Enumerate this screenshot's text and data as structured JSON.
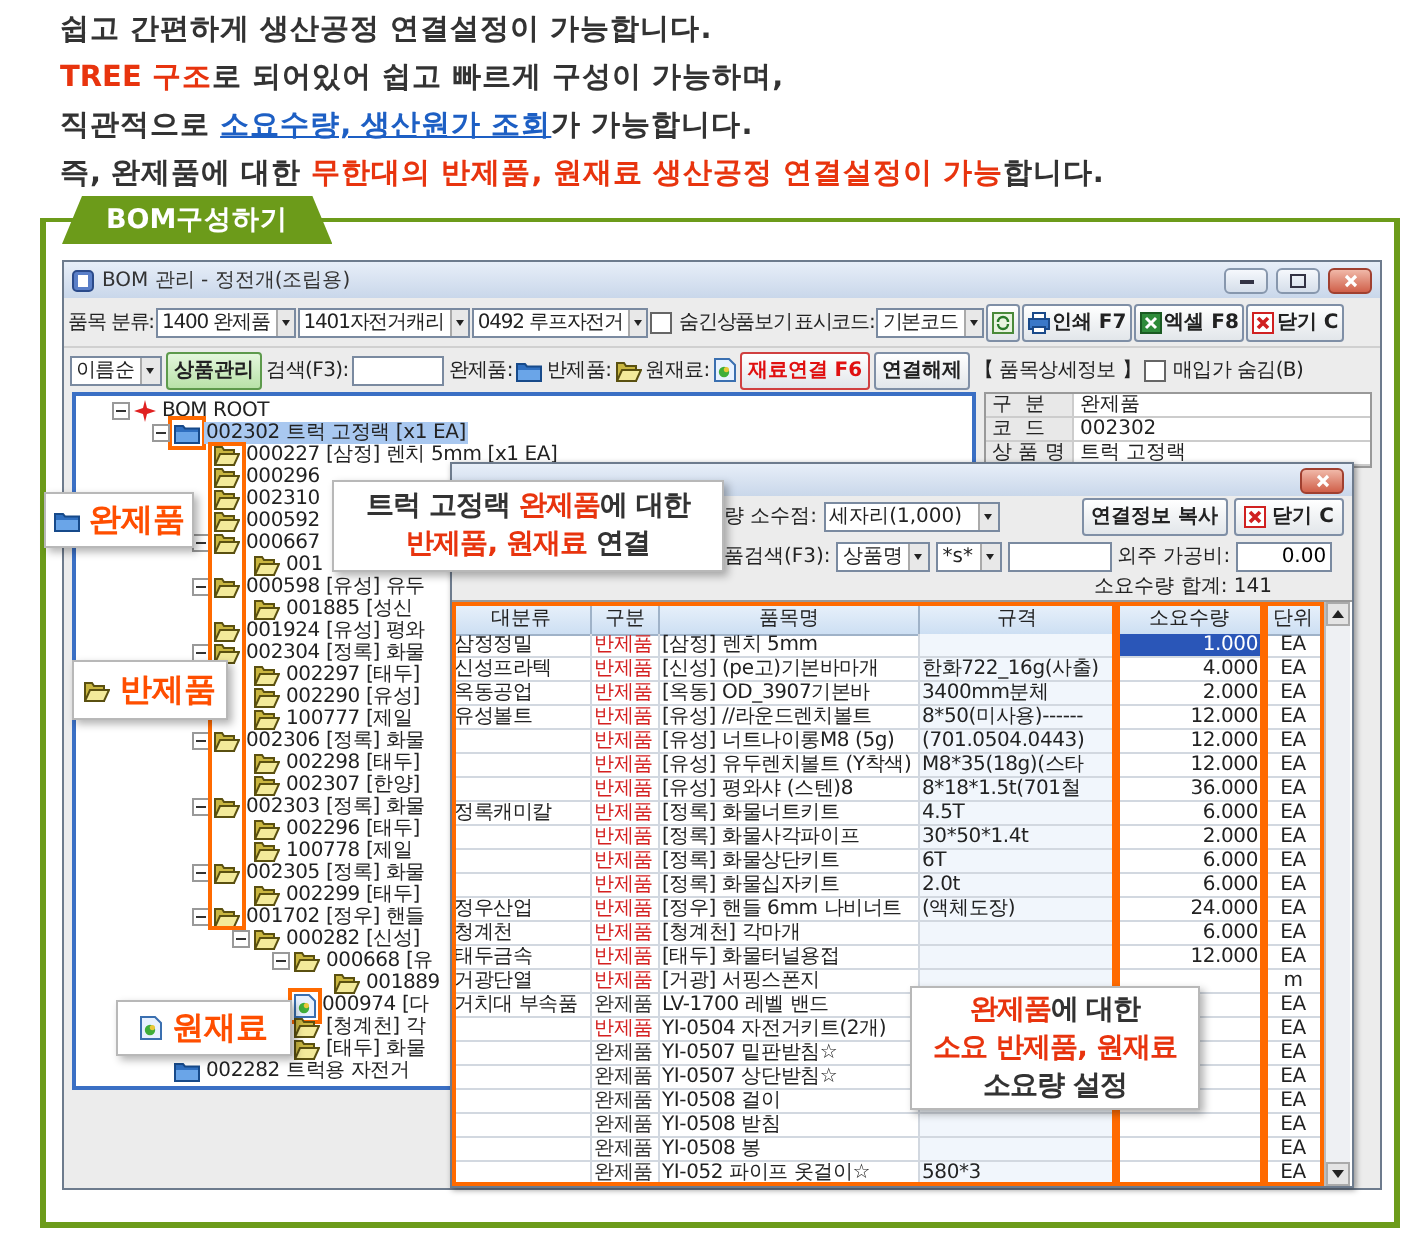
{
  "intro": [
    [
      {
        "text": "쉽고 간편하게 생산공정 연결설정이 가능합니다.",
        "kind": "plain"
      }
    ],
    [
      {
        "text": "TREE 구조",
        "kind": "accent"
      },
      {
        "text": "로 되어있어 쉽고 빠르게 구성이 가능하며,",
        "kind": "plain"
      }
    ],
    [
      {
        "text": "직관적으로 ",
        "kind": "plain"
      },
      {
        "text": "소요수량, 생산원가 조회",
        "kind": "link"
      },
      {
        "text": "가 가능합니다.",
        "kind": "plain"
      }
    ],
    [
      {
        "text": "즉, 완제품에 대한 ",
        "kind": "plain"
      },
      {
        "text": "무한대의 반제품, 원재료 생산공정 연결설정이 가능",
        "kind": "accent"
      },
      {
        "text": "합니다.",
        "kind": "plain"
      }
    ]
  ],
  "section": {
    "title": "BOM구성하기"
  },
  "window": {
    "title": "BOM 관리 - 정전개(조립용)"
  },
  "toolbar": {
    "category_label": "품목 분류:",
    "category": "1400 완제품",
    "subcategory": "1401자전거캐리",
    "item_group": "0492 루프자전거",
    "hidden_items": {
      "label": "숨긴상품보기",
      "checked": false
    },
    "code_label": "표시코드:",
    "code": "기본코드",
    "print": "인쇄 F7",
    "excel": "엑셀 F8",
    "close": "닫기 C"
  },
  "toolbar2": {
    "sort": "이름순",
    "manage": "상품관리",
    "search_label": "검색(F3):",
    "legend": [
      {
        "label": "완제품:",
        "kind": "finished"
      },
      {
        "label": "반제품:",
        "kind": "semi"
      },
      {
        "label": "원재료:",
        "kind": "raw"
      }
    ],
    "link": "재료연결 F6",
    "unlink": "연결해제",
    "detail": "【 품목상세정보 】",
    "hide_cost": {
      "label": "매입가 숨김(B)",
      "checked": false
    }
  },
  "tree": {
    "nodes": [
      {
        "label": "BOM ROOT",
        "kind": "root",
        "selected": false,
        "expanded": true,
        "children": [
          {
            "label": "002302 트럭 고정랙 [x1 EA]",
            "kind": "finished",
            "selected": true,
            "annotated": true,
            "expanded": true,
            "children": [
              {
                "label": "000227 [삼정] 렌치 5mm [x1 EA]",
                "kind": "semi",
                "selected": false
              },
              {
                "label": "000296",
                "kind": "semi",
                "selected": false
              },
              {
                "label": "002310",
                "kind": "semi",
                "selected": false
              },
              {
                "label": "000592",
                "kind": "semi",
                "selected": false
              },
              {
                "label": "000667",
                "kind": "semi",
                "selected": false,
                "expanded": true,
                "children": [
                  {
                    "label": "001",
                    "kind": "semi",
                    "selected": false
                  }
                ]
              },
              {
                "label": "000598 [유성] 유두",
                "kind": "semi",
                "selected": false,
                "expanded": true,
                "children": [
                  {
                    "label": "001885 [성신",
                    "kind": "semi",
                    "selected": false
                  }
                ]
              },
              {
                "label": "001924 [유성] 평와",
                "kind": "semi",
                "selected": false
              },
              {
                "label": "002304 [정록] 화물",
                "kind": "semi",
                "selected": false,
                "expanded": true,
                "children": [
                  {
                    "label": "002297 [태두]",
                    "kind": "semi",
                    "selected": false
                  },
                  {
                    "label": "002290 [유성]",
                    "kind": "semi",
                    "selected": false
                  },
                  {
                    "label": "100777 [제일",
                    "kind": "semi",
                    "selected": false
                  }
                ]
              },
              {
                "label": "002306 [정록] 화물",
                "kind": "semi",
                "selected": false,
                "expanded": true,
                "children": [
                  {
                    "label": "002298 [태두]",
                    "kind": "semi",
                    "selected": false
                  },
                  {
                    "label": "002307 [한양]",
                    "kind": "semi",
                    "selected": false
                  }
                ]
              },
              {
                "label": "002303 [정록] 화물",
                "kind": "semi",
                "selected": false,
                "expanded": true,
                "children": [
                  {
                    "label": "002296 [태두]",
                    "kind": "semi",
                    "selected": false
                  },
                  {
                    "label": "100778 [제일",
                    "kind": "semi",
                    "selected": false
                  }
                ]
              },
              {
                "label": "002305 [정록] 화물",
                "kind": "semi",
                "selected": false,
                "expanded": true,
                "children": [
                  {
                    "label": "002299 [태두]",
                    "kind": "semi",
                    "selected": false
                  }
                ]
              },
              {
                "label": "001702 [정우] 핸들",
                "kind": "semi",
                "selected": false,
                "expanded": true,
                "children": [
                  {
                    "label": "000282 [신성]",
                    "kind": "semi",
                    "selected": false,
                    "expanded": true,
                    "children": [
                      {
                        "label": "000668 [유",
                        "kind": "semi",
                        "selected": false,
                        "expanded": true,
                        "children": [
                          {
                            "label": "001889",
                            "kind": "semi",
                            "selected": false
                          }
                        ]
                      },
                      {
                        "label": "000974 [다",
                        "kind": "raw",
                        "selected": false,
                        "annotated": true
                      },
                      {
                        "label": "[청계천] 각",
                        "kind": "semi",
                        "selected": false
                      },
                      {
                        "label": "[태두] 화물",
                        "kind": "semi",
                        "selected": false
                      }
                    ]
                  }
                ]
              }
            ]
          },
          {
            "label": "002282 트럭용 자전거",
            "kind": "finished",
            "selected": false
          }
        ]
      }
    ]
  },
  "info": [
    {
      "label": "구  분",
      "value": "완제품"
    },
    {
      "label": "코  드",
      "value": "002302"
    },
    {
      "label": "상 품 명",
      "value": "트럭 고정랙"
    }
  ],
  "dialog": {
    "decimal_label": "량 소수점:",
    "decimal": "세자리(1,000)",
    "copy": "연결정보 복사",
    "close": "닫기 C",
    "search_label": "품검색(F3):",
    "search_field": "상품명",
    "match": "*s*",
    "outsource_label": "외주 가공비:",
    "outsource": "0.00",
    "total": "소요수량 합계: 141",
    "columns": [
      "대분류",
      "구분",
      "품목명",
      "규격",
      "소요수량",
      "단위"
    ],
    "rows": [
      {
        "category": "삼정정밀",
        "kind": "semi",
        "type": "반제품",
        "name": "[삼정] 렌치 5mm",
        "qty": "1.000",
        "unit": "EA",
        "selected": true
      },
      {
        "category": "신성프라텍",
        "kind": "semi",
        "type": "반제품",
        "name": "[신성] (pe고)기본바마개",
        "spec": "한화722_16g(사출)",
        "qty": "4.000",
        "unit": "EA",
        "selected": false
      },
      {
        "category": "옥동공업",
        "kind": "semi",
        "type": "반제품",
        "name": "[옥동] OD_3907기본바",
        "spec": "3400mm분체",
        "qty": "2.000",
        "unit": "EA",
        "selected": false
      },
      {
        "category": "유성볼트",
        "kind": "semi",
        "type": "반제품",
        "name": "[유성] //라운드렌치볼트",
        "spec": "8*50(미사용)------",
        "qty": "12.000",
        "unit": "EA",
        "selected": false
      },
      {
        "kind": "semi",
        "type": "반제품",
        "name": "[유성] 너트나이롱M8 (5g)",
        "spec": "(701.0504.0443)",
        "qty": "12.000",
        "unit": "EA",
        "selected": false
      },
      {
        "kind": "semi",
        "type": "반제품",
        "name": "[유성] 유두렌치볼트 (Y착색)",
        "spec": "M8*35(18g)(스타",
        "qty": "12.000",
        "unit": "EA",
        "selected": false
      },
      {
        "kind": "semi",
        "type": "반제품",
        "name": "[유성] 평와샤 (스텐)8",
        "spec": "8*18*1.5t(701철",
        "qty": "36.000",
        "unit": "EA",
        "selected": false
      },
      {
        "category": "정록캐미칼",
        "kind": "semi",
        "type": "반제품",
        "name": "[정록] 화물너트키트",
        "spec": "4.5T",
        "qty": "6.000",
        "unit": "EA",
        "selected": false
      },
      {
        "kind": "semi",
        "type": "반제품",
        "name": "[정록] 화물사각파이프",
        "spec": "30*50*1.4t",
        "qty": "2.000",
        "unit": "EA",
        "selected": false
      },
      {
        "kind": "semi",
        "type": "반제품",
        "name": "[정록] 화물상단키트",
        "spec": "6T",
        "qty": "6.000",
        "unit": "EA",
        "selected": false
      },
      {
        "kind": "semi",
        "type": "반제품",
        "name": "[정록] 화물십자키트",
        "spec": "2.0t",
        "qty": "6.000",
        "unit": "EA",
        "selected": false
      },
      {
        "category": "정우산업",
        "kind": "semi",
        "type": "반제품",
        "name": "[정우] 핸들 6mm 나비너트",
        "spec": "(액체도장)",
        "qty": "24.000",
        "unit": "EA",
        "selected": false
      },
      {
        "category": "청계천",
        "kind": "semi",
        "type": "반제품",
        "name": "[청계천] 각마개",
        "qty": "6.000",
        "unit": "EA",
        "selected": false
      },
      {
        "category": "태두금속",
        "kind": "semi",
        "type": "반제품",
        "name": "[태두] 화물터널용접",
        "qty": "12.000",
        "unit": "EA",
        "selected": false
      },
      {
        "category": "거광단열",
        "kind": "semi",
        "type": "반제품",
        "name": "[거광] 서핑스폰지",
        "unit": "m",
        "selected": false
      },
      {
        "category": "거치대 부속품",
        "kind": "finished",
        "type": "완제품",
        "name": "LV-1700 레벨 밴드",
        "unit": "EA",
        "selected": false
      },
      {
        "kind": "semi",
        "type": "반제품",
        "name": "YI-0504 자전거키트(2개)",
        "unit": "EA",
        "selected": false
      },
      {
        "kind": "finished",
        "type": "완제품",
        "name": "YI-0507 밑판받침☆",
        "unit": "EA",
        "selected": false
      },
      {
        "kind": "finished",
        "type": "완제품",
        "name": "YI-0507 상단받침☆",
        "unit": "EA",
        "selected": false
      },
      {
        "kind": "finished",
        "type": "완제품",
        "name": "YI-0508 걸이",
        "unit": "EA",
        "selected": false
      },
      {
        "kind": "finished",
        "type": "완제품",
        "name": "YI-0508 받침",
        "unit": "EA",
        "selected": false
      },
      {
        "kind": "finished",
        "type": "완제품",
        "name": "YI-0508 봉",
        "unit": "EA",
        "selected": false
      },
      {
        "kind": "finished",
        "type": "완제품",
        "name": "YI-052 파이프 옷걸이☆",
        "spec": "580*3",
        "unit": "EA",
        "selected": false
      }
    ]
  },
  "callouts": [
    {
      "kind": "finished",
      "label": "완제품"
    },
    {
      "kind": "note",
      "lines": [
        [
          {
            "text": "트럭 고정랙 ",
            "kind": "plain"
          },
          {
            "text": "완제품",
            "kind": "accent"
          },
          {
            "text": "에 대한",
            "kind": "plain"
          }
        ],
        [
          {
            "text": "반제품, 원재료",
            "kind": "accent"
          },
          {
            "text": " 연결",
            "kind": "plain"
          }
        ]
      ]
    },
    {
      "kind": "semi",
      "label": "반제품"
    },
    {
      "kind": "raw",
      "label": "원재료"
    },
    {
      "kind": "note",
      "lines": [
        [
          {
            "text": "완제품",
            "kind": "accent"
          },
          {
            "text": "에 대한",
            "kind": "plain"
          }
        ],
        [
          {
            "text": "소요 반제품, 원재료",
            "kind": "accent"
          }
        ],
        [
          {
            "text": "소요량 설정",
            "kind": "plain"
          }
        ]
      ]
    }
  ]
}
